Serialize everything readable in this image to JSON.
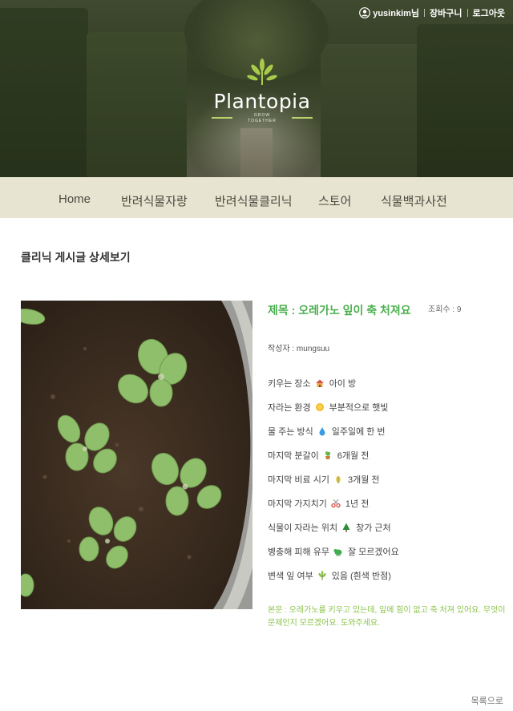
{
  "header": {
    "username": "yusinkim님",
    "cart_label": "장바구니",
    "logout_label": "로그아웃",
    "logo_name": "Plantopia",
    "logo_tagline_1": "GROW",
    "logo_tagline_2": "TOGETHER"
  },
  "nav": {
    "items": [
      {
        "label": "Home"
      },
      {
        "label": "반려식물자랑"
      },
      {
        "label": "반려식물클리닉"
      },
      {
        "label": "스토어"
      },
      {
        "label": "식물백과사전"
      }
    ]
  },
  "page": {
    "title": "클리닉 게시글 상세보기"
  },
  "post": {
    "title": "제목 : 오레가노 잎이 축 처져요",
    "views": "조회수 : 9",
    "author": "작성자 : mungsuu",
    "details": [
      {
        "key": "키우는 장소",
        "icon": "house-icon",
        "value": "아이 방"
      },
      {
        "key": "자라는 환경",
        "icon": "sun-icon",
        "value": "부분적으로 햇빛"
      },
      {
        "key": "물 주는 방식",
        "icon": "droplet-icon",
        "value": "일주일에 한 번"
      },
      {
        "key": "마지막 분갈이",
        "icon": "potted-plant-icon",
        "value": "6개월 전"
      },
      {
        "key": "마지막 비료 시기",
        "icon": "fertilizer-icon",
        "value": "3개월 전"
      },
      {
        "key": "마지막 가지치기",
        "icon": "scissors-icon",
        "value": "1년 전"
      },
      {
        "key": "식물이 자라는 위치",
        "icon": "tree-icon",
        "value": "창가 근처"
      },
      {
        "key": "병충해 피해 유무",
        "icon": "bug-icon",
        "value": "잘 모르겠어요"
      },
      {
        "key": "변색 잎 여부",
        "icon": "herb-icon",
        "value": "있음 (흰색 반점)"
      }
    ],
    "body": "본문 : 오레가노를 키우고 있는데, 잎에 힘이 없고 축 처져 있어요. 무엇이 문제인지 모르겠어요. 도와주세요."
  },
  "footer": {
    "list_link": "목록으로"
  },
  "colors": {
    "accent_green": "#4caf50",
    "body_text_green": "#8bc34a",
    "nav_bg": "#e7e4d2"
  }
}
